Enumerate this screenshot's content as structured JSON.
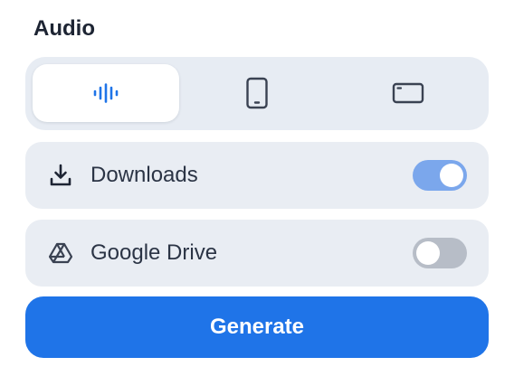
{
  "section": {
    "title": "Audio"
  },
  "format_options": [
    {
      "icon": "audio-waveform-icon",
      "selected": true
    },
    {
      "icon": "phone-icon",
      "selected": false
    },
    {
      "icon": "widescreen-icon",
      "selected": false
    }
  ],
  "destinations": [
    {
      "label": "Downloads",
      "icon": "download-icon",
      "enabled": true
    },
    {
      "label": "Google Drive",
      "icon": "google-drive-icon",
      "enabled": false
    }
  ],
  "generate": {
    "label": "Generate"
  },
  "colors": {
    "accent": "#1f74e8",
    "toggle_on": "#7ba7ec",
    "toggle_off": "#b7bdc7",
    "panel": "#e9edf3"
  }
}
